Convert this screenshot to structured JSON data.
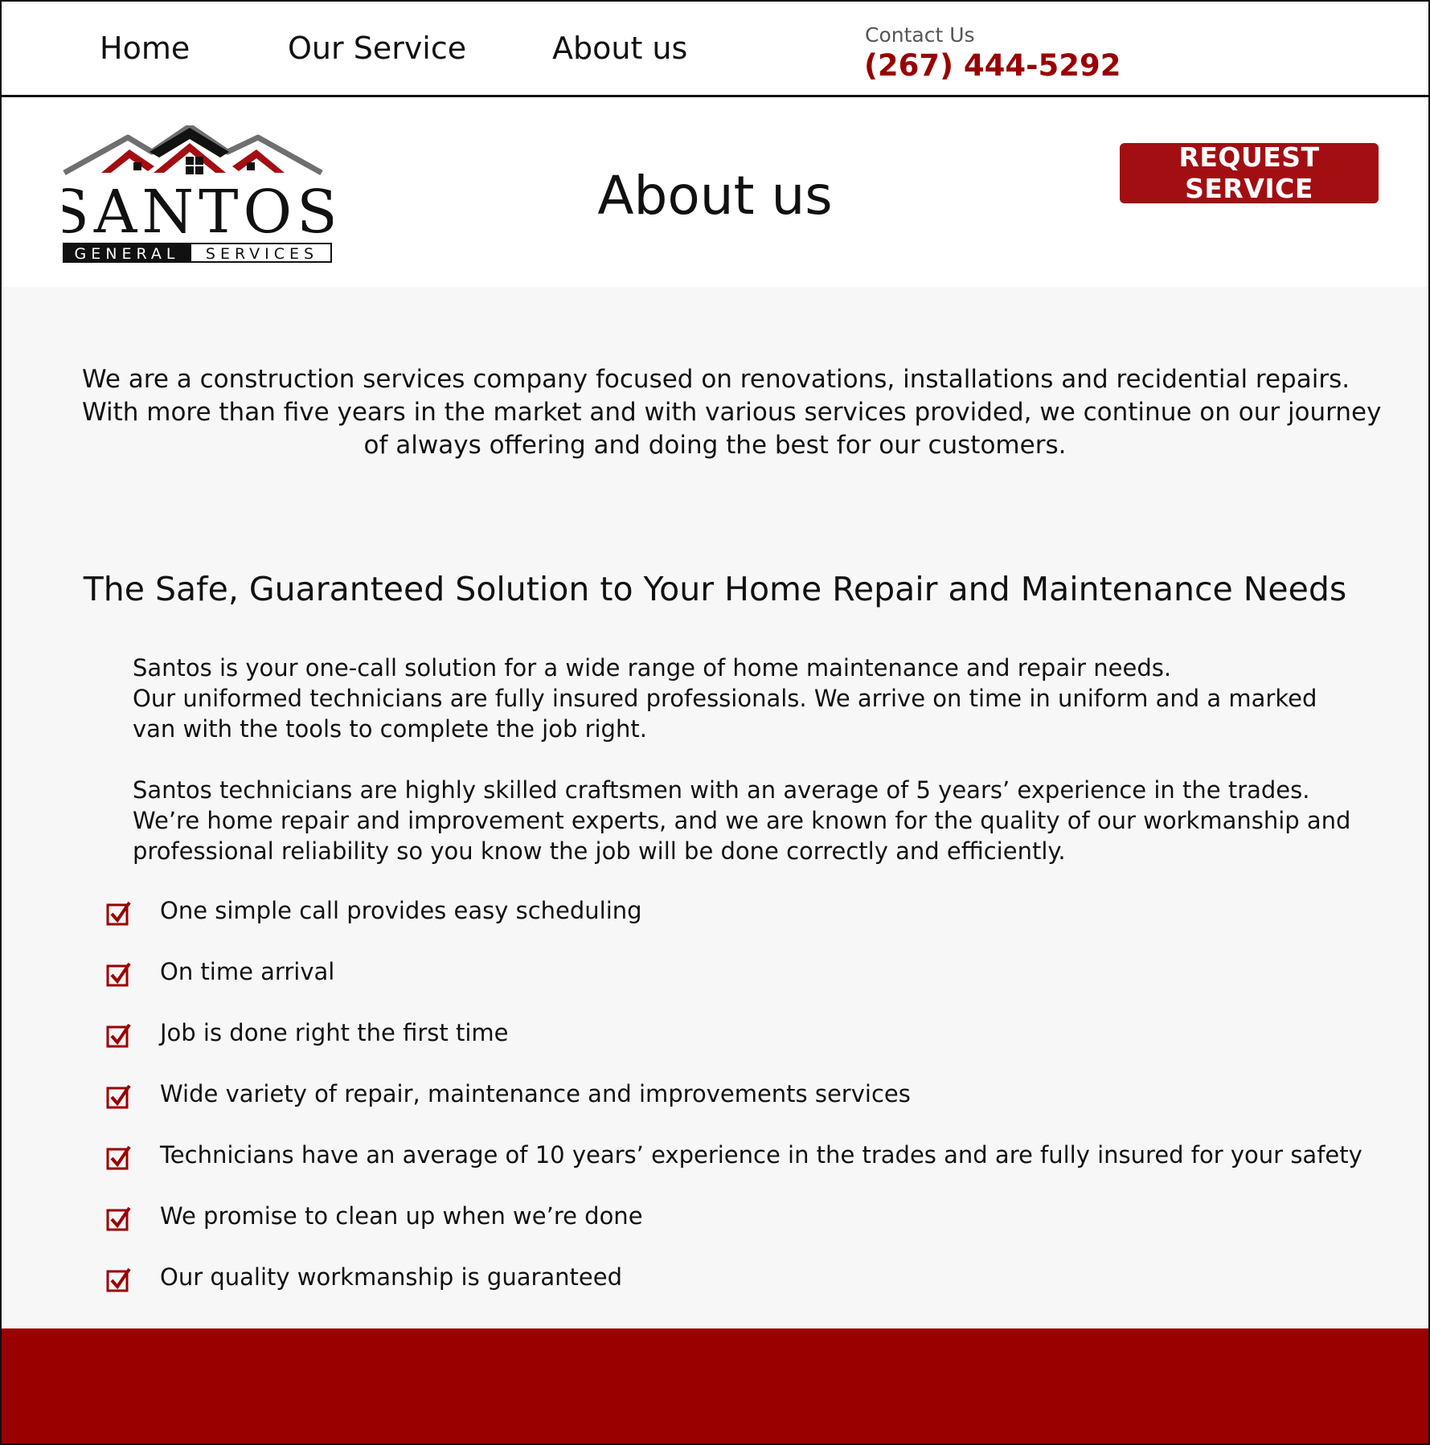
{
  "nav": {
    "items": [
      {
        "label": "Home"
      },
      {
        "label": "Our Service"
      },
      {
        "label": "About us"
      }
    ],
    "contact_label": "Contact Us",
    "phone": "(267) 444-5292"
  },
  "header": {
    "logo_alt": "SANTOS GENERAL SERVICES",
    "title": "About us",
    "request_button": "REQUEST SERVICE"
  },
  "intro": {
    "lines": [
      "We are a construction services company focused on renovations, installations and recidential repairs.",
      "With more than five years in the market and with various services provided, we continue on our journey",
      "of always offering and doing the best for our customers."
    ]
  },
  "section": {
    "heading": "The Safe, Guaranteed Solution to Your Home Repair and Maintenance Needs",
    "paragraph1": [
      "Santos is your one-call solution for a wide range of home maintenance and repair needs.",
      "Our uniformed technicians are fully insured professionals. We arrive on time in uniform and a marked",
      "van with the tools to complete the job right."
    ],
    "paragraph2": [
      "Santos technicians are highly skilled craftsmen with an average of 5 years’ experience in the trades.",
      "We’re home repair and improvement experts, and we are known for the quality of our workmanship and",
      "professional reliability so you know the job will be done correctly and efficiently."
    ],
    "checklist": [
      "One simple call provides easy scheduling",
      "On time arrival",
      "Job is done right the first time",
      "Wide variety of repair, maintenance and improvements services",
      "Technicians have an average of 10 years’ experience in the trades and are fully insured for your safety",
      "We promise to clean up when we’re done",
      "Our quality workmanship is guaranteed"
    ]
  },
  "colors": {
    "brand_red": "#990000",
    "button_red": "#a30e12",
    "background_gray": "#f7f7f7"
  },
  "icons": {
    "checklist": "checkbox-checked-icon"
  }
}
